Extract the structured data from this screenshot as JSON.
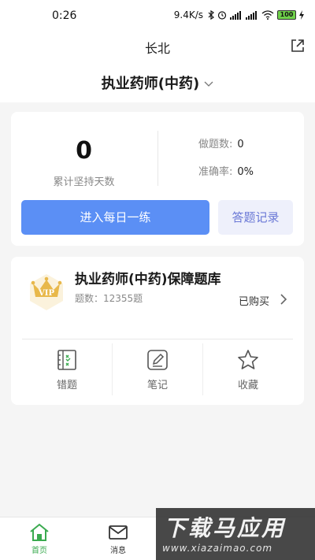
{
  "status_bar": {
    "time": "0:26",
    "speed": "9.4K/s",
    "battery": "100"
  },
  "header": {
    "title": "长北",
    "share_icon": "share-icon",
    "course": "执业药师(中药)"
  },
  "stats": {
    "days_value": "0",
    "days_label": "累计坚持天数",
    "done_label": "做题数:",
    "done_value": "0",
    "accuracy_label": "准确率:",
    "accuracy_value": "0%",
    "daily_button": "进入每日一练",
    "records_button": "答题记录"
  },
  "bank": {
    "vip_text": "VIP",
    "title": "执业药师(中药)保障题库",
    "count": "题数：12355题",
    "status": "已购买",
    "tools": [
      {
        "label": "错题",
        "icon": "wrong-questions-icon"
      },
      {
        "label": "笔记",
        "icon": "notes-icon"
      },
      {
        "label": "收藏",
        "icon": "star-icon"
      }
    ]
  },
  "tabbar": {
    "tabs": [
      {
        "label": "首页",
        "icon": "home-icon"
      },
      {
        "label": "消息",
        "icon": "mail-icon"
      }
    ]
  },
  "watermark": {
    "big": "下载马应用",
    "small": "www.xiazaimao.com"
  },
  "colors": {
    "primary": "#5b8ff5",
    "accent_green": "#3aaa4f",
    "records_text": "#6a78d6",
    "vip_gold": "#e8b84a"
  }
}
